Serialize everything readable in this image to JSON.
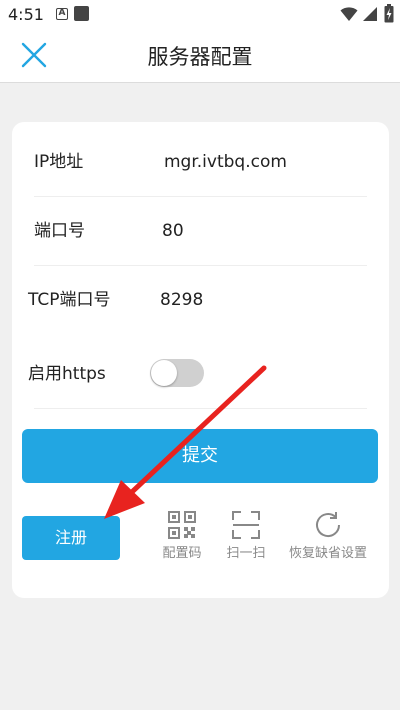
{
  "statusbar": {
    "time": "4:51",
    "notification_a": "A"
  },
  "header": {
    "title": "服务器配置"
  },
  "form": {
    "ip_label": "IP地址",
    "ip_value": "mgr.ivtbq.com",
    "port_label": "端口号",
    "port_value": "80",
    "tcp_port_label": "TCP端口号",
    "tcp_port_value": "8298",
    "https_label": "启用https",
    "https_enabled": false
  },
  "buttons": {
    "submit_label": "提交",
    "register_label": "注册"
  },
  "tools": [
    {
      "label": "配置码",
      "icon": "qr-code-icon"
    },
    {
      "label": "扫一扫",
      "icon": "scan-icon"
    },
    {
      "label": "恢复缺省设置",
      "icon": "refresh-icon"
    }
  ],
  "colors": {
    "accent": "#22a6e2",
    "annotation_arrow": "#e8231f",
    "toggle_off": "#d0d0d0"
  }
}
